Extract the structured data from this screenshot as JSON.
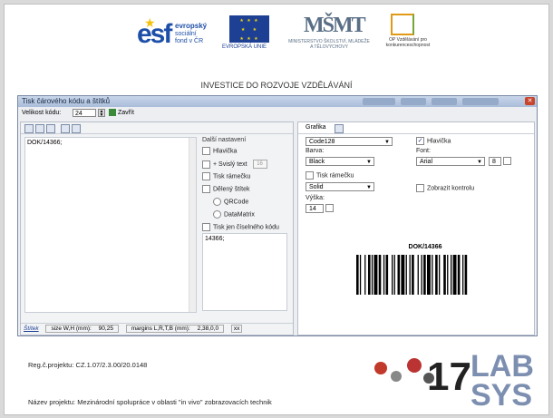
{
  "header": {
    "esf_brand": "esf",
    "esf_lines": [
      "evropský",
      "sociální",
      "fond v ČR"
    ],
    "eu_caption": "EVROPSKÁ UNIE",
    "msmt_brand": "MŠMT",
    "msmt_caption": "MINISTERSTVO ŠKOLSTVÍ, MLÁDEŽE A TĚLOVÝCHOVY",
    "op_caption": "OP Vzdělávání pro konkurenceschopnost",
    "slogan": "INVESTICE DO ROZVOJE VZDĚLÁVÁNÍ"
  },
  "window": {
    "title": "Tisk čárového kódu a štítků",
    "toolbar": {
      "size_label": "Velikost kódu:",
      "size_value": "24",
      "close_label": "Zavřít"
    },
    "left": {
      "text_value": "DOK/14366;",
      "options_header": "Další nastavení",
      "opt_header": "Hlavička",
      "opt_vertical": "+ Svislý text",
      "opt_vertical_value": "16",
      "opt_frame": "Tisk rámečku",
      "opt_split": "Dělený štítek",
      "radio_qr": "QRCode",
      "radio_dm": "DataMatrix",
      "opt_number_only": "Tisk jen číselného kódu",
      "code_value": "14366;",
      "status": {
        "link": "Štítek",
        "size": "size W,H (mm):",
        "size_value": "90,25",
        "margins": "margins L,R,T,B (mm):",
        "margins_value": "2,38,0,0",
        "extra": "xx"
      }
    },
    "right": {
      "tab_graphics": "Grafika",
      "code_type": "Code128",
      "color_label": "Barva:",
      "color_value": "Black",
      "frame_label": "Tisk rámečku",
      "line_value": "Solid",
      "height_label": "Výška:",
      "height_value": "14",
      "header_check": "Hlavička",
      "font_label": "Font:",
      "font_value": "Arial",
      "font_size": "8",
      "show_control": "Zobrazit kontrolu",
      "barcode_text": "DOK/14366"
    }
  },
  "footer": {
    "reg": "Reg.č.projektu: CZ.1.07/2.3.00/20.0148",
    "project": "Název projektu: Mezinárodní spolupráce v oblasti \"in vivo\" zobrazovacích technik",
    "logo_lab": "LAB",
    "logo_sys": "SYS",
    "logo_num": "17"
  }
}
